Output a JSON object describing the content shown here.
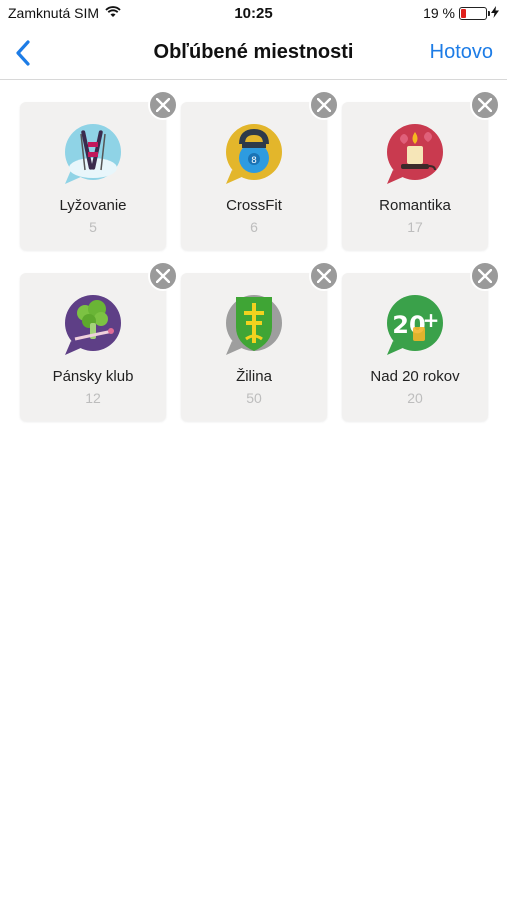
{
  "status": {
    "carrier": "Zamknutá SIM",
    "time": "10:25",
    "battery": "19 %"
  },
  "nav": {
    "title": "Obľúbené miestnosti",
    "done_label": "Hotovo"
  },
  "colors": {
    "accent": "#1d7ce6",
    "close_button": "#9a9a9a",
    "card_bg": "#f2f1f0"
  },
  "rooms": [
    {
      "name": "Lyžovanie",
      "count": "5",
      "icon": "skiing-icon"
    },
    {
      "name": "CrossFit",
      "count": "6",
      "icon": "kettlebell-icon"
    },
    {
      "name": "Romantika",
      "count": "17",
      "icon": "candle-icon"
    },
    {
      "name": "Pánsky klub",
      "count": "12",
      "icon": "broccoli-icon"
    },
    {
      "name": "Žilina",
      "count": "50",
      "icon": "zilina-coat-of-arms-icon"
    },
    {
      "name": "Nad 20 rokov",
      "count": "20",
      "icon": "age-20-plus-icon"
    }
  ]
}
